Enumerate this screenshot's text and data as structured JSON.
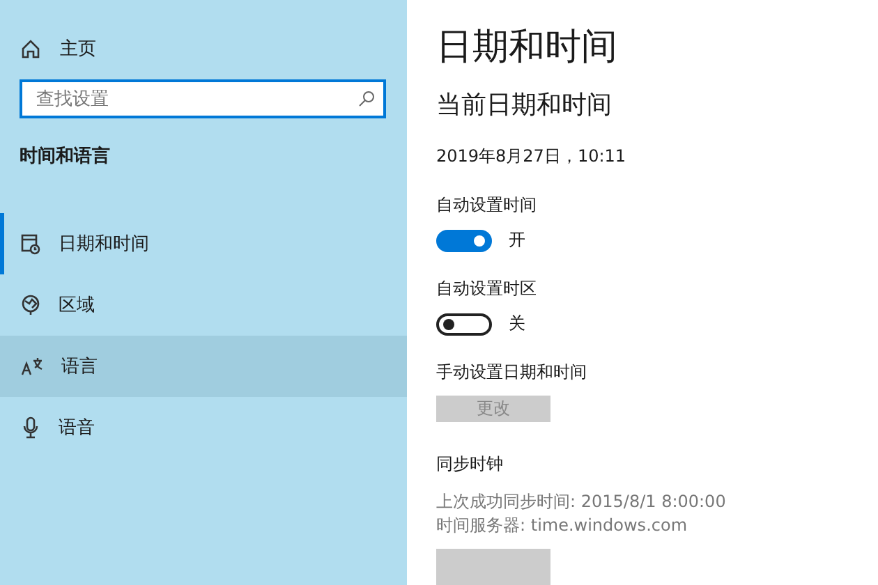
{
  "sidebar": {
    "home": "主页",
    "search": {
      "placeholder": "查找设置"
    },
    "heading": "时间和语言",
    "items": [
      {
        "label": "日期和时间",
        "selected": true,
        "hovered": false
      },
      {
        "label": "区域",
        "selected": false,
        "hovered": false
      },
      {
        "label": "语言",
        "selected": false,
        "hovered": true
      },
      {
        "label": "语音",
        "selected": false,
        "hovered": false
      }
    ]
  },
  "main": {
    "title": "日期和时间",
    "subtitle": "当前日期和时间",
    "current": "2019年8月27日，10:11",
    "toggles": [
      {
        "label": "自动设置时间",
        "on": true,
        "state_text": "开"
      },
      {
        "label": "自动设置时区",
        "on": false,
        "state_text": "关"
      }
    ],
    "manual": {
      "label": "手动设置日期和时间",
      "button": {
        "label": "更改",
        "disabled": true
      }
    },
    "sync": {
      "heading": "同步时钟",
      "lines": [
        "上次成功同步时间: 2015/8/1 8:00:00",
        "时间服务器: time.windows.com"
      ]
    }
  }
}
